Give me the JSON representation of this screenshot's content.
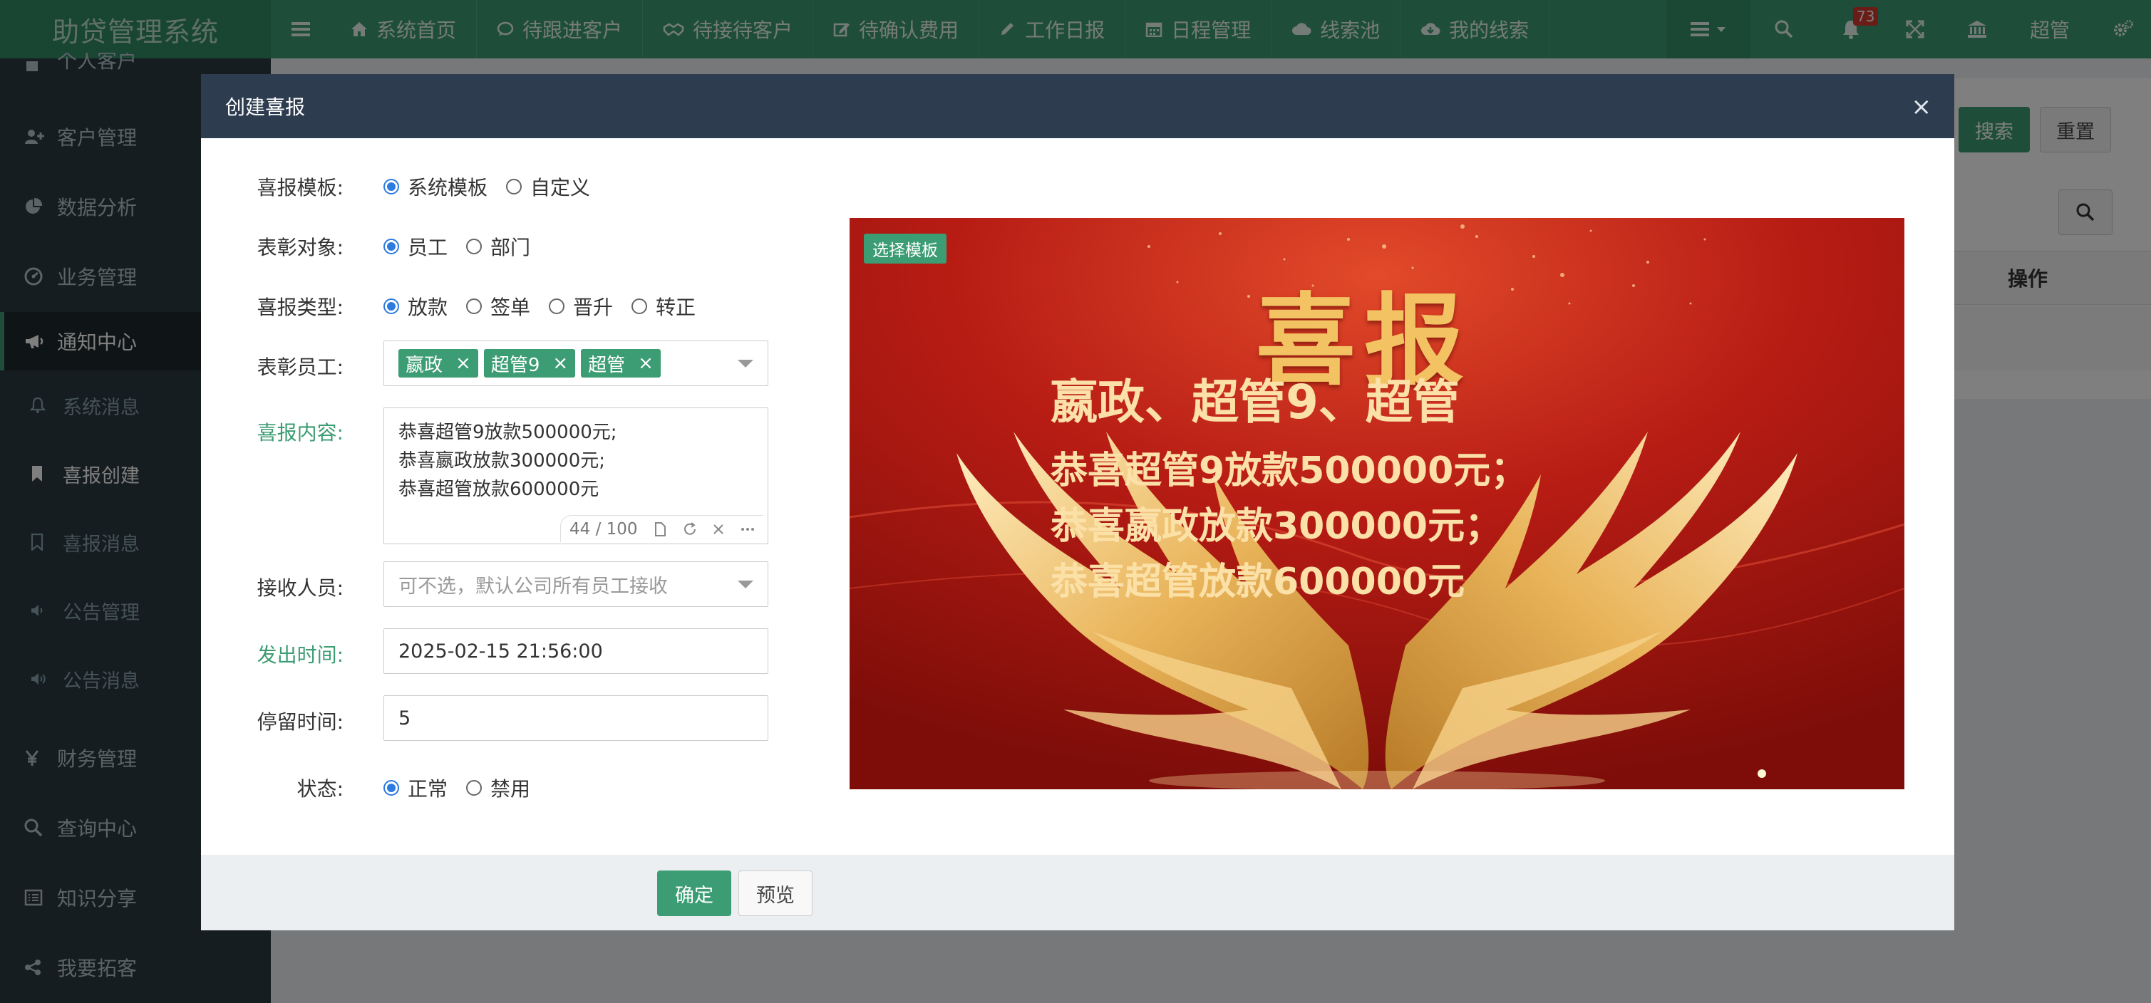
{
  "app": {
    "title": "助贷管理系统"
  },
  "navbar": {
    "items": [
      {
        "label": "系统首页",
        "icon": "home-icon"
      },
      {
        "label": "待跟进客户",
        "icon": "comment-icon"
      },
      {
        "label": "待接待客户",
        "icon": "handshake-icon"
      },
      {
        "label": "待确认费用",
        "icon": "edit-icon"
      },
      {
        "label": "工作日报",
        "icon": "pencil-icon"
      },
      {
        "label": "日程管理",
        "icon": "calendar-icon"
      },
      {
        "label": "线索池",
        "icon": "cloud-icon"
      },
      {
        "label": "我的线索",
        "icon": "cloud-download-icon"
      }
    ],
    "notifications": "73",
    "user": "超管"
  },
  "sidebar": {
    "top_partial": "个人客户",
    "items": [
      {
        "label": "客户管理",
        "icon": "user-plus-icon"
      },
      {
        "label": "数据分析",
        "icon": "pie-chart-icon"
      },
      {
        "label": "业务管理",
        "icon": "dashboard-icon"
      },
      {
        "label": "通知中心",
        "icon": "bullhorn-icon"
      }
    ],
    "sub_items": [
      {
        "label": "系统消息",
        "icon": "bell-icon"
      },
      {
        "label": "喜报创建",
        "icon": "bookmark-icon"
      },
      {
        "label": "喜报消息",
        "icon": "bookmark-outline-icon"
      },
      {
        "label": "公告管理",
        "icon": "volume-down-icon"
      },
      {
        "label": "公告消息",
        "icon": "volume-up-icon"
      }
    ],
    "bottom_items": [
      {
        "label": "财务管理",
        "icon": "yen-icon"
      },
      {
        "label": "查询中心",
        "icon": "search-icon"
      },
      {
        "label": "知识分享",
        "icon": "list-alt-icon"
      },
      {
        "label": "我要拓客",
        "icon": "share-icon"
      }
    ]
  },
  "page": {
    "search_label": "搜索",
    "reset_label": "重置",
    "table_header_op": "操作"
  },
  "modal": {
    "title": "创建喜报",
    "close": "×",
    "fields": {
      "template": {
        "label": "喜报模板:",
        "options": [
          "系统模板",
          "自定义"
        ],
        "selected": "系统模板"
      },
      "target": {
        "label": "表彰对象:",
        "options": [
          "员工",
          "部门"
        ],
        "selected": "员工"
      },
      "type": {
        "label": "喜报类型:",
        "options": [
          "放款",
          "签单",
          "晋升",
          "转正"
        ],
        "selected": "放款"
      },
      "employees": {
        "label": "表彰员工:",
        "tags": [
          "嬴政",
          "超管9",
          "超管"
        ]
      },
      "content": {
        "label": "喜报内容:",
        "lines": [
          "恭喜超管9放款500000元;",
          "恭喜嬴政放款300000元;",
          "恭喜超管放款600000元"
        ],
        "counter": "44 / 100"
      },
      "receivers": {
        "label": "接收人员:",
        "placeholder": "可不选，默认公司所有员工接收"
      },
      "send_time": {
        "label": "发出时间:",
        "value": "2025-02-15 21:56:00"
      },
      "stay_time": {
        "label": "停留时间:",
        "value": "5"
      },
      "status": {
        "label": "状态:",
        "options": [
          "正常",
          "禁用"
        ],
        "selected": "正常"
      }
    },
    "poster": {
      "tag": "选择模板",
      "title": "喜报",
      "names": "嬴政、超管9、超管",
      "lines": [
        "恭喜超管9放款500000元；",
        "恭喜嬴政放款300000元；",
        "恭喜超管放款600000元"
      ]
    },
    "footer": {
      "ok_label": "确定",
      "preview_label": "预览"
    }
  },
  "colors": {
    "brand": "#3c9c73",
    "sidebar": "#2c3b41",
    "modal_header": "#2e3c4f",
    "poster_red": "#b51c14",
    "gold": "#f3c262"
  }
}
